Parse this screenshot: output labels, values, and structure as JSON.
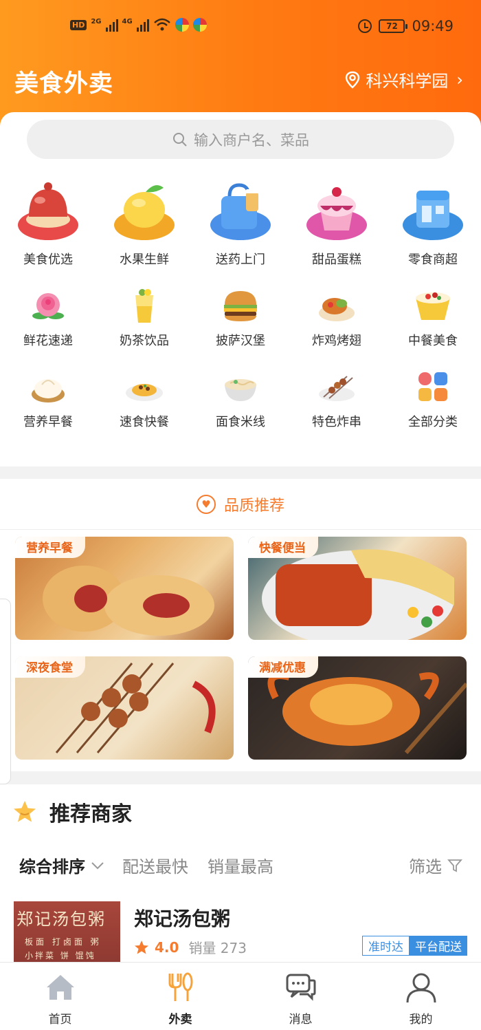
{
  "status_bar": {
    "hd": "HD",
    "net1": "2G",
    "net2": "4G",
    "battery": "72",
    "time": "09:49"
  },
  "header": {
    "title": "美食外卖",
    "location": "科兴科学园"
  },
  "search": {
    "placeholder": "输入商户名、菜品"
  },
  "categories": [
    {
      "label": "美食优选",
      "icon": "food-dome-icon"
    },
    {
      "label": "水果生鲜",
      "icon": "mango-icon"
    },
    {
      "label": "送药上门",
      "icon": "medicine-bag-icon"
    },
    {
      "label": "甜品蛋糕",
      "icon": "ice-cream-icon"
    },
    {
      "label": "零食商超",
      "icon": "store-icon"
    },
    {
      "label": "鲜花速递",
      "icon": "rose-icon"
    },
    {
      "label": "奶茶饮品",
      "icon": "drink-icon"
    },
    {
      "label": "披萨汉堡",
      "icon": "burger-icon"
    },
    {
      "label": "炸鸡烤翅",
      "icon": "fried-chicken-icon"
    },
    {
      "label": "中餐美食",
      "icon": "chinese-food-icon"
    },
    {
      "label": "营养早餐",
      "icon": "dumpling-icon"
    },
    {
      "label": "速食快餐",
      "icon": "fast-food-icon"
    },
    {
      "label": "面食米线",
      "icon": "noodle-icon"
    },
    {
      "label": "特色炸串",
      "icon": "skewer-icon"
    },
    {
      "label": "全部分类",
      "icon": "grid-icon"
    }
  ],
  "quality": {
    "title": "品质推荐",
    "tiles": [
      {
        "tag": "营养早餐"
      },
      {
        "tag": "快餐便当"
      },
      {
        "tag": "深夜食堂"
      },
      {
        "tag": "满减优惠"
      }
    ]
  },
  "recommend": {
    "title": "推荐商家",
    "sorts": [
      "综合排序",
      "配送最快",
      "销量最高"
    ],
    "filter": "筛选",
    "merchant": {
      "name": "郑记汤包粥",
      "rating": "4.0",
      "sales": "销量 273",
      "tag1": "准时达",
      "tag2": "平台配送",
      "sign_line1": "郑记汤包粥",
      "sign_line2": "板面 打卤面 粥",
      "sign_line3": "小拌菜 饼 馄饨"
    }
  },
  "nav": [
    {
      "label": "首页",
      "icon": "home-icon"
    },
    {
      "label": "外卖",
      "icon": "utensils-icon"
    },
    {
      "label": "消息",
      "icon": "message-icon"
    },
    {
      "label": "我的",
      "icon": "user-icon"
    }
  ],
  "colors": {
    "accent": "#f57c2e",
    "header_start": "#ff9a1f",
    "header_end": "#ff6a0e",
    "tag_blue": "#3b8fe0"
  }
}
